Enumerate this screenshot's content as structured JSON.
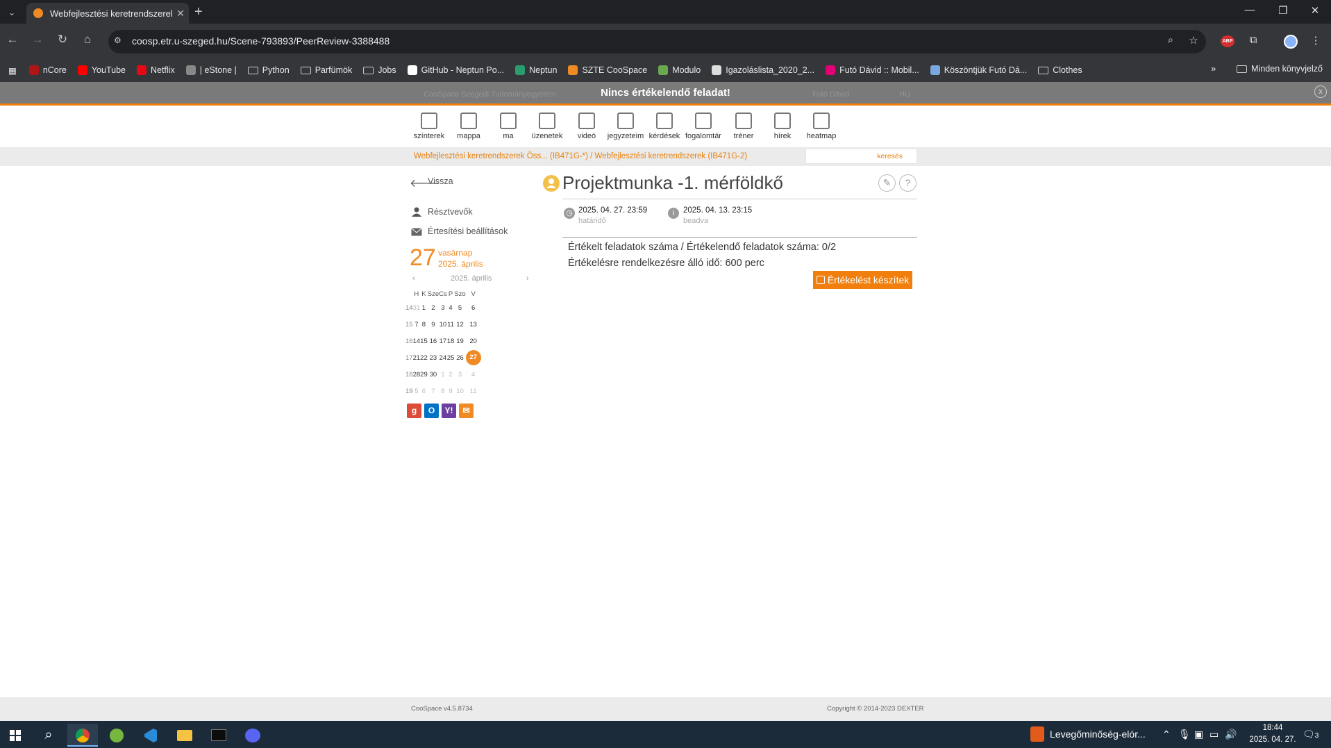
{
  "browser": {
    "tab_title": "Webfejlesztési keretrendszerek",
    "tab_close": "✕",
    "new_tab": "+",
    "url": "coosp.etr.u-szeged.hu/Scene-793893/PeerReview-3388488",
    "window_controls": [
      "—",
      "❐",
      "✕"
    ],
    "bookmarks": [
      {
        "label": "nCore",
        "icon": "ncore-icon",
        "color": "#b01515"
      },
      {
        "label": "YouTube",
        "icon": "youtube-icon",
        "color": "#ff0000"
      },
      {
        "label": "Netflix",
        "icon": "netflix-icon",
        "color": "#e50914"
      },
      {
        "label": "| eStone |",
        "icon": "estone-icon",
        "color": "#888888"
      },
      {
        "label": "Python",
        "icon": "folder-icon",
        "color": ""
      },
      {
        "label": "Parfümök",
        "icon": "folder-icon",
        "color": ""
      },
      {
        "label": "Jobs",
        "icon": "folder-icon",
        "color": ""
      },
      {
        "label": "GitHub - Neptun Po...",
        "icon": "github-icon",
        "color": "#ffffff"
      },
      {
        "label": "Neptun",
        "icon": "neptun-icon",
        "color": "#2a9d6f"
      },
      {
        "label": "SZTE CooSpace",
        "icon": "coospace-icon",
        "color": "#f08a24"
      },
      {
        "label": "Modulo",
        "icon": "modulo-icon",
        "color": "#6aa84f"
      },
      {
        "label": "Igazoláslista_2020_2...",
        "icon": "doc-icon",
        "color": "#dddddd"
      },
      {
        "label": "Futó Dávid :: Mobil...",
        "icon": "telekom-icon",
        "color": "#e20074"
      },
      {
        "label": "Köszöntjük Futó Dá...",
        "icon": "link-icon",
        "color": "#7aa7e0"
      },
      {
        "label": "Clothes",
        "icon": "folder-icon",
        "color": ""
      }
    ],
    "bookmarks_overflow": "»",
    "all_bookmarks": "Minden könyvjelző"
  },
  "header": {
    "notice": "Nincs értékelendő feladat!",
    "ghost_left": "CooSpace   Szegedi Tudományegyetem",
    "ghost_user": "Futó Dávid",
    "ghost_lang": "HU",
    "close": "x"
  },
  "menu": [
    {
      "label": "színterek",
      "icon": "scenes-icon"
    },
    {
      "label": "mappa",
      "icon": "folder-icon"
    },
    {
      "label": "ma",
      "icon": "calendar-today-icon"
    },
    {
      "label": "üzenetek",
      "icon": "mail-icon"
    },
    {
      "label": "videó",
      "icon": "video-icon"
    },
    {
      "label": "jegyzeteim",
      "icon": "pencil-icon"
    },
    {
      "label": "kérdések",
      "icon": "questions-icon"
    },
    {
      "label": "fogalomtár",
      "icon": "glossary-icon"
    },
    {
      "label": "tréner",
      "icon": "trainer-icon"
    },
    {
      "label": "hírek",
      "icon": "news-icon"
    },
    {
      "label": "heatmap",
      "icon": "heatmap-icon"
    }
  ],
  "breadcrumb": "Webfejlesztési keretrendszerek Öss... (IB471G-*) / Webfejlesztési keretrendszerek (IB471G-2)",
  "search_label": "keresés",
  "sidebar": {
    "back": "Vissza",
    "participants": "Résztvevők",
    "notifications": "Értesítési beállítások",
    "day_number": "27",
    "day_name": "vasárnap",
    "day_month": "2025. április"
  },
  "calendar": {
    "prev": "‹",
    "next": "›",
    "month": "2025. április",
    "weekdays": [
      "H",
      "K",
      "Sze",
      "Cs",
      "P",
      "Szo",
      "V"
    ],
    "weeks": [
      {
        "wk": "14",
        "days": [
          "31",
          "1",
          "2",
          "3",
          "4",
          "5",
          "6"
        ]
      },
      {
        "wk": "15",
        "days": [
          "7",
          "8",
          "9",
          "10",
          "11",
          "12",
          "13"
        ]
      },
      {
        "wk": "16",
        "days": [
          "14",
          "15",
          "16",
          "17",
          "18",
          "19",
          "20"
        ]
      },
      {
        "wk": "17",
        "days": [
          "21",
          "22",
          "23",
          "24",
          "25",
          "26",
          "27"
        ]
      },
      {
        "wk": "18",
        "days": [
          "28",
          "29",
          "30",
          "1",
          "2",
          "3",
          "4"
        ]
      },
      {
        "wk": "19",
        "days": [
          "5",
          "6",
          "7",
          "8",
          "9",
          "10",
          "11"
        ]
      }
    ],
    "today": "27",
    "export_icons": [
      {
        "name": "google-calendar-icon",
        "glyph": "g",
        "color": "#dd4b39"
      },
      {
        "name": "outlook-icon",
        "glyph": "O",
        "color": "#0072c6"
      },
      {
        "name": "yahoo-icon",
        "glyph": "Y!",
        "color": "#6b3fa0"
      },
      {
        "name": "email-icon",
        "glyph": "✉",
        "color": "#f08a24"
      }
    ]
  },
  "main": {
    "title": "Projektmunka -1. mérföldkő",
    "edit_glyph": "✎",
    "help_glyph": "?",
    "deadline_value": "2025. 04. 27. 23:59",
    "deadline_label": "határidő",
    "submitted_value": "2025. 04. 13. 23:15",
    "submitted_label": "beadva",
    "info_glyph": "i",
    "line1": "Értékelt feladatok száma / Értékelendő feladatok száma: 0/2",
    "line2": "Értékelésre rendelkezésre álló idő: 600 perc",
    "eval_button": "Értékelést készítek"
  },
  "footer": {
    "version": "CooSpace v4.5.8734",
    "copyright": "Copyright © 2014-2023 DEXTER"
  },
  "taskbar": {
    "weather": "Levegőminőség-elór...",
    "time": "18:44",
    "date": "2025. 04. 27.",
    "notifications": "3"
  },
  "colors": {
    "accent": "#f08a24",
    "header_bar": "#7a7a7a",
    "chrome_dark": "#202124",
    "chrome_mid": "#35363a"
  }
}
